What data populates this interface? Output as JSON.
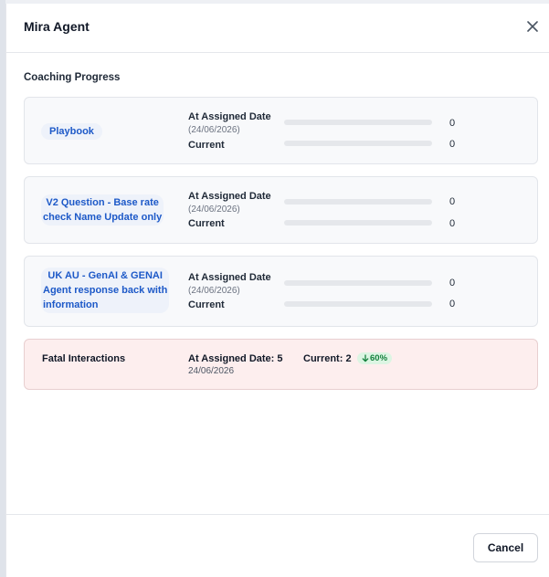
{
  "modal": {
    "title": "Mira Agent",
    "close_icon": "close-icon"
  },
  "section": {
    "title": "Coaching Progress"
  },
  "coaching_items": [
    {
      "name_lines": [
        "Playbook"
      ],
      "assigned_label": "At Assigned Date",
      "assigned_date": "(24/06/2026)",
      "current_label": "Current",
      "assigned_value": "0",
      "current_value": "0",
      "assigned_progress": 0,
      "current_progress": 0
    },
    {
      "name_lines": [
        "V2 Question - Base rate",
        "check Name Update only"
      ],
      "assigned_label": "At Assigned Date",
      "assigned_date": "(24/06/2026)",
      "current_label": "Current",
      "assigned_value": "0",
      "current_value": "0",
      "assigned_progress": 0,
      "current_progress": 0
    },
    {
      "name_lines": [
        "UK AU - GenAI & GENAI",
        "Agent response back with",
        "information"
      ],
      "assigned_label": "At Assigned Date",
      "assigned_date": "(24/06/2026)",
      "current_label": "Current",
      "assigned_value": "0",
      "current_value": "0",
      "assigned_progress": 0,
      "current_progress": 0
    }
  ],
  "fatal": {
    "label": "Fatal Interactions",
    "assigned_text": "At Assigned Date: 5",
    "assigned_date": "24/06/2026",
    "current_text": "Current: 2",
    "trend_text": "60%",
    "trend_icon": "arrow-down-icon",
    "bg_color": "#fdeeee",
    "trend_color": "#15803d"
  },
  "footer": {
    "cancel_label": "Cancel"
  },
  "colors": {
    "accent": "#1d59c8",
    "pill_bg": "#eef2fa"
  }
}
